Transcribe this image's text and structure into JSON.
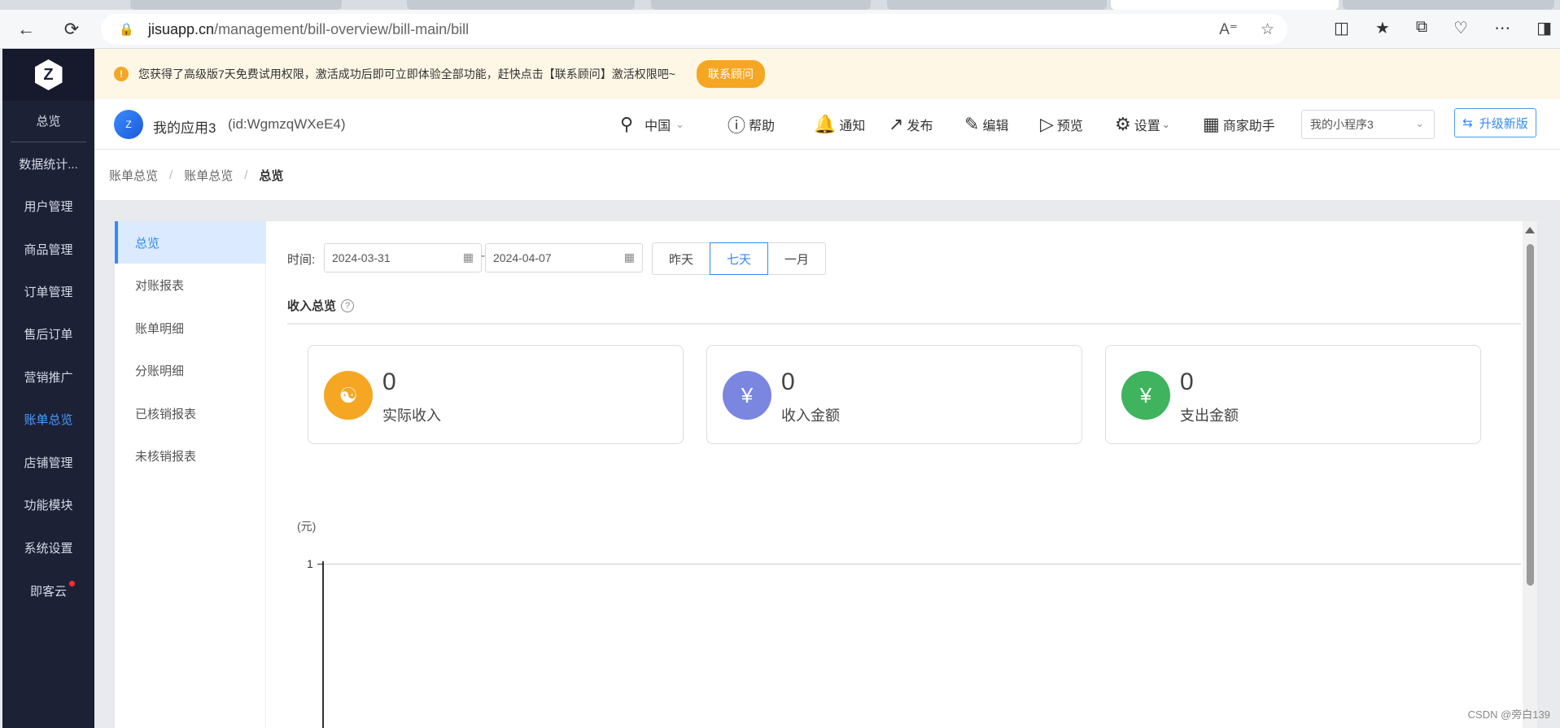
{
  "browser": {
    "url_host": "jisuapp.cn",
    "url_path": "/management/bill-overview/bill-main/bill"
  },
  "sidebar": {
    "items": [
      {
        "label": "总览"
      },
      {
        "label": "数据统计..."
      },
      {
        "label": "用户管理"
      },
      {
        "label": "商品管理"
      },
      {
        "label": "订单管理"
      },
      {
        "label": "售后订单"
      },
      {
        "label": "营销推广"
      },
      {
        "label": "账单总览"
      },
      {
        "label": "店铺管理"
      },
      {
        "label": "功能模块"
      },
      {
        "label": "系统设置"
      },
      {
        "label": "即客云"
      }
    ],
    "active_label": "账单总览"
  },
  "notice": {
    "icon": "!",
    "text": "您获得了高级版7天免费试用权限，激活成功后即可立即体验全部功能，赶快点击【联系顾问】激活权限吧~",
    "button": "联系顾问"
  },
  "header": {
    "app_name": "我的应用3",
    "app_id": "(id:WgmzqWXeE4)",
    "region": "中国",
    "help": "帮助",
    "notify": "通知",
    "publish": "发布",
    "edit": "编辑",
    "preview": "预览",
    "settings": "设置",
    "assistant": "商家助手",
    "mini_program": "我的小程序3",
    "upgrade": "升级新版"
  },
  "breadcrumb": {
    "items": [
      "账单总览",
      "账单总览",
      "总览"
    ]
  },
  "subnav": {
    "items": [
      {
        "label": "总览"
      },
      {
        "label": "对账报表"
      },
      {
        "label": "账单明细"
      },
      {
        "label": "分账明细"
      },
      {
        "label": "已核销报表"
      },
      {
        "label": "未核销报表"
      }
    ]
  },
  "filter": {
    "time_label": "时间:",
    "start_date": "2024-03-31",
    "end_date": "2024-04-07",
    "dash": "-",
    "ranges": [
      "昨天",
      "七天",
      "一月"
    ],
    "selected_range": "七天"
  },
  "income": {
    "title": "收入总览",
    "cards": [
      {
        "value": "0",
        "label": "实际收入",
        "color": "#f5a623",
        "icon": "coins-icon"
      },
      {
        "value": "0",
        "label": "收入金额",
        "color": "#7b86e0",
        "icon": "yuan-refresh-icon"
      },
      {
        "value": "0",
        "label": "支出金额",
        "color": "#3fb35d",
        "icon": "yuan-export-icon"
      }
    ]
  },
  "chart_data": {
    "type": "line",
    "ylabel": "(元)",
    "y_ticks": [
      "1"
    ],
    "series": []
  },
  "watermark": "CSDN @旁白139"
}
